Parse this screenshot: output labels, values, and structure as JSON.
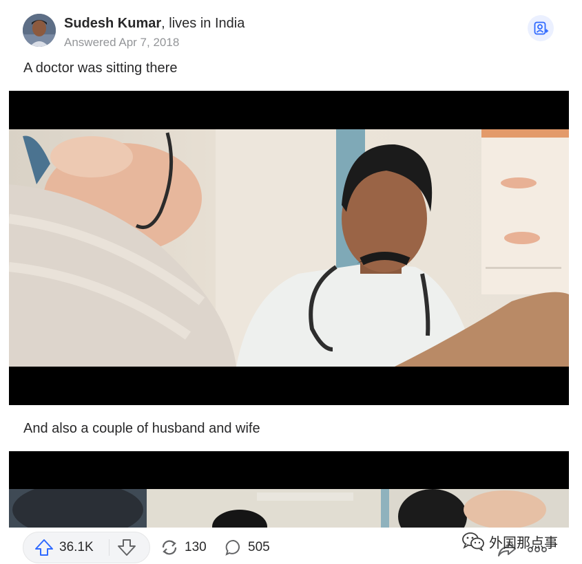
{
  "post": {
    "author_name": "Sudesh Kumar",
    "author_credential": ", lives in India",
    "answered": "Answered Apr 7, 2018",
    "paragraphs": [
      "A doctor was sitting there",
      "And also a couple of husband and wife"
    ]
  },
  "actions": {
    "upvotes": "36.1K",
    "shares": "130",
    "comments": "505"
  },
  "watermark": {
    "text": "外国那点事"
  },
  "icons": {
    "follow": "follow-person-icon",
    "upvote": "upvote-arrow-icon",
    "downvote": "downvote-arrow-icon",
    "share": "reshare-icon",
    "comment": "comment-bubble-icon",
    "wechat": "wechat-logo-icon",
    "more": "more-dots-icon"
  },
  "colors": {
    "accent": "#2e69ff",
    "text": "#282829",
    "muted": "#939598"
  }
}
